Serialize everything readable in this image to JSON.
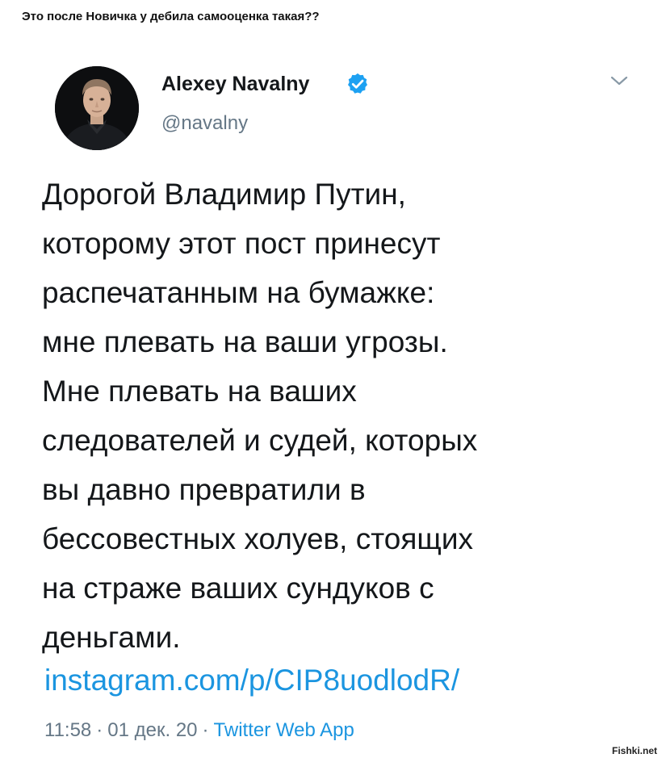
{
  "post": {
    "title": "Это после Новичка у дебила самооценка такая??"
  },
  "tweet": {
    "author_name": "Alexey Navalny",
    "handle": "@navalny",
    "verified": true,
    "avatar_icon": "profile-photo",
    "text_lines": [
      "Дорогой Владимир Путин,",
      "которому этот пост принесут",
      "распечатанным на бумажке:",
      "мне плевать на ваши угрозы.",
      "Мне плевать на ваших",
      "следователей и судей, которых",
      "вы давно превратили в",
      "бессовестных холуев, стоящих",
      "на страже ваших сундуков с",
      "деньгами."
    ],
    "link": "instagram.com/p/CIP8uodlodR/",
    "time": "11:58",
    "date": "01 дек. 20",
    "separator": "·",
    "source": "Twitter Web App",
    "menu_icon": "chevron-down-icon"
  },
  "watermark": "Fishki.net",
  "colors": {
    "text": "#14171a",
    "secondary": "#657786",
    "link": "#1b95e0",
    "verified": "#1da1f2"
  }
}
